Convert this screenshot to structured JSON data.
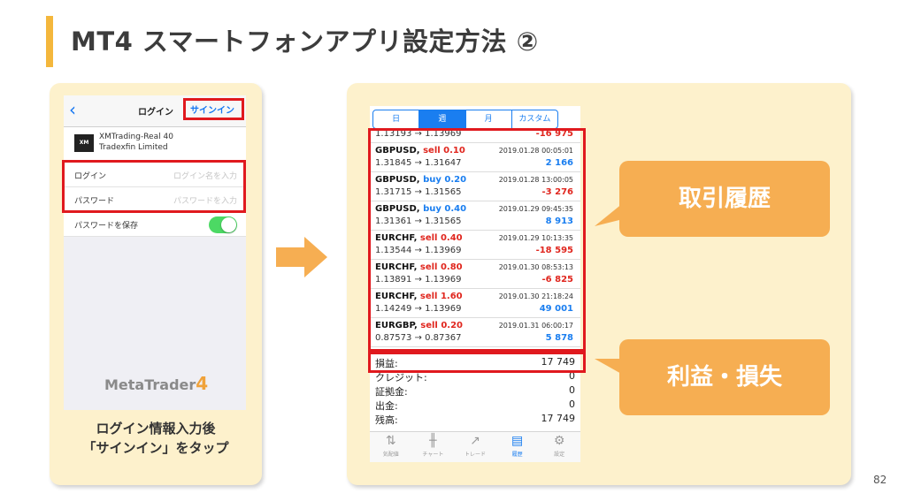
{
  "slide": {
    "title": "MT4 スマートフォンアプリ設定方法 ②",
    "page_number": "82",
    "accent_color": "#f4b73c"
  },
  "login_screen": {
    "nav": {
      "back_icon": "chevron-left-icon",
      "title": "ログイン",
      "signin_label": "サインイン"
    },
    "server": {
      "name": "XMTrading-Real 40",
      "company": "Tradexfin Limited"
    },
    "fields": [
      {
        "label": "ログイン",
        "placeholder": "ログイン名を入力"
      },
      {
        "label": "パスワード",
        "placeholder": "パスワードを入力"
      }
    ],
    "save_password": {
      "label": "パスワードを保存",
      "on": true
    },
    "brand": {
      "text": "MetaTrader",
      "number": "4"
    }
  },
  "caption": {
    "line1": "ログイン情報入力後",
    "line2": "「サインイン」をタップ"
  },
  "history_screen": {
    "tabs": [
      {
        "label": "日",
        "active": false
      },
      {
        "label": "週",
        "active": true
      },
      {
        "label": "月",
        "active": false
      },
      {
        "label": "カスタム",
        "active": false
      }
    ],
    "partial_row": {
      "price": "1.13193 → 1.13969",
      "profit": "-16 975"
    },
    "trades": [
      {
        "symbol": "GBPUSD,",
        "side": "sell 0.10",
        "type": "sell",
        "time": "2019.01.28 00:05:01",
        "price": "1.31845 → 1.31647",
        "profit": "2 166",
        "positive": true
      },
      {
        "symbol": "GBPUSD,",
        "side": "buy 0.20",
        "type": "buy",
        "time": "2019.01.28 13:00:05",
        "price": "1.31715 → 1.31565",
        "profit": "-3 276",
        "positive": false
      },
      {
        "symbol": "GBPUSD,",
        "side": "buy 0.40",
        "type": "buy",
        "time": "2019.01.29 09:45:35",
        "price": "1.31361 → 1.31565",
        "profit": "8 913",
        "positive": true
      },
      {
        "symbol": "EURCHF,",
        "side": "sell 0.40",
        "type": "sell",
        "time": "2019.01.29 10:13:35",
        "price": "1.13544 → 1.13969",
        "profit": "-18 595",
        "positive": false
      },
      {
        "symbol": "EURCHF,",
        "side": "sell 0.80",
        "type": "sell",
        "time": "2019.01.30 08:53:13",
        "price": "1.13891 → 1.13969",
        "profit": "-6 825",
        "positive": false
      },
      {
        "symbol": "EURCHF,",
        "side": "sell 1.60",
        "type": "sell",
        "time": "2019.01.30 21:18:24",
        "price": "1.14249 → 1.13969",
        "profit": "49 001",
        "positive": true
      },
      {
        "symbol": "EURGBP,",
        "side": "sell 0.20",
        "type": "sell",
        "time": "2019.01.31 06:00:17",
        "price": "0.87573 → 0.87367",
        "profit": "5 878",
        "positive": true
      }
    ],
    "summary": [
      {
        "label": "損益:",
        "value": "17 749"
      },
      {
        "label": "クレジット:",
        "value": "0"
      },
      {
        "label": "証拠金:",
        "value": "0"
      },
      {
        "label": "出金:",
        "value": "0"
      },
      {
        "label": "残高:",
        "value": "17 749"
      }
    ],
    "tabbar": [
      {
        "label": "気配値",
        "icon": "arrows-icon",
        "active": false
      },
      {
        "label": "チャート",
        "icon": "candlestick-icon",
        "active": false
      },
      {
        "label": "トレード",
        "icon": "trend-icon",
        "active": false
      },
      {
        "label": "履歴",
        "icon": "inbox-icon",
        "active": true
      },
      {
        "label": "設定",
        "icon": "gear-icon",
        "active": false
      }
    ]
  },
  "callouts": {
    "history": "取引履歴",
    "profit_loss": "利益・損失"
  },
  "colors": {
    "sell": "#e0261e",
    "buy": "#1a7ef0",
    "positive": "#1a7ef0",
    "negative": "#e0261e",
    "highlight_border": "#e0191e",
    "callout": "#f6ae52",
    "panel": "#fdf1cc"
  }
}
